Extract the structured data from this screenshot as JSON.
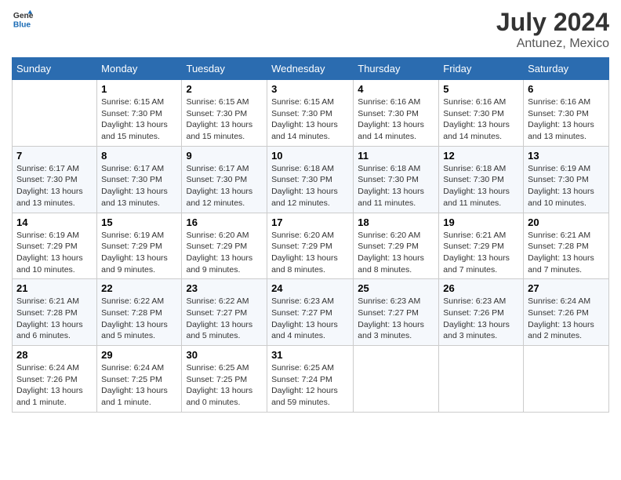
{
  "header": {
    "logo_line1": "General",
    "logo_line2": "Blue",
    "month_year": "July 2024",
    "location": "Antunez, Mexico"
  },
  "days_of_week": [
    "Sunday",
    "Monday",
    "Tuesday",
    "Wednesday",
    "Thursday",
    "Friday",
    "Saturday"
  ],
  "weeks": [
    [
      {
        "day": "",
        "info": ""
      },
      {
        "day": "1",
        "info": "Sunrise: 6:15 AM\nSunset: 7:30 PM\nDaylight: 13 hours and 15 minutes."
      },
      {
        "day": "2",
        "info": "Sunrise: 6:15 AM\nSunset: 7:30 PM\nDaylight: 13 hours and 15 minutes."
      },
      {
        "day": "3",
        "info": "Sunrise: 6:15 AM\nSunset: 7:30 PM\nDaylight: 13 hours and 14 minutes."
      },
      {
        "day": "4",
        "info": "Sunrise: 6:16 AM\nSunset: 7:30 PM\nDaylight: 13 hours and 14 minutes."
      },
      {
        "day": "5",
        "info": "Sunrise: 6:16 AM\nSunset: 7:30 PM\nDaylight: 13 hours and 14 minutes."
      },
      {
        "day": "6",
        "info": "Sunrise: 6:16 AM\nSunset: 7:30 PM\nDaylight: 13 hours and 13 minutes."
      }
    ],
    [
      {
        "day": "7",
        "info": "Sunrise: 6:17 AM\nSunset: 7:30 PM\nDaylight: 13 hours and 13 minutes."
      },
      {
        "day": "8",
        "info": "Sunrise: 6:17 AM\nSunset: 7:30 PM\nDaylight: 13 hours and 13 minutes."
      },
      {
        "day": "9",
        "info": "Sunrise: 6:17 AM\nSunset: 7:30 PM\nDaylight: 13 hours and 12 minutes."
      },
      {
        "day": "10",
        "info": "Sunrise: 6:18 AM\nSunset: 7:30 PM\nDaylight: 13 hours and 12 minutes."
      },
      {
        "day": "11",
        "info": "Sunrise: 6:18 AM\nSunset: 7:30 PM\nDaylight: 13 hours and 11 minutes."
      },
      {
        "day": "12",
        "info": "Sunrise: 6:18 AM\nSunset: 7:30 PM\nDaylight: 13 hours and 11 minutes."
      },
      {
        "day": "13",
        "info": "Sunrise: 6:19 AM\nSunset: 7:30 PM\nDaylight: 13 hours and 10 minutes."
      }
    ],
    [
      {
        "day": "14",
        "info": "Sunrise: 6:19 AM\nSunset: 7:29 PM\nDaylight: 13 hours and 10 minutes."
      },
      {
        "day": "15",
        "info": "Sunrise: 6:19 AM\nSunset: 7:29 PM\nDaylight: 13 hours and 9 minutes."
      },
      {
        "day": "16",
        "info": "Sunrise: 6:20 AM\nSunset: 7:29 PM\nDaylight: 13 hours and 9 minutes."
      },
      {
        "day": "17",
        "info": "Sunrise: 6:20 AM\nSunset: 7:29 PM\nDaylight: 13 hours and 8 minutes."
      },
      {
        "day": "18",
        "info": "Sunrise: 6:20 AM\nSunset: 7:29 PM\nDaylight: 13 hours and 8 minutes."
      },
      {
        "day": "19",
        "info": "Sunrise: 6:21 AM\nSunset: 7:29 PM\nDaylight: 13 hours and 7 minutes."
      },
      {
        "day": "20",
        "info": "Sunrise: 6:21 AM\nSunset: 7:28 PM\nDaylight: 13 hours and 7 minutes."
      }
    ],
    [
      {
        "day": "21",
        "info": "Sunrise: 6:21 AM\nSunset: 7:28 PM\nDaylight: 13 hours and 6 minutes."
      },
      {
        "day": "22",
        "info": "Sunrise: 6:22 AM\nSunset: 7:28 PM\nDaylight: 13 hours and 5 minutes."
      },
      {
        "day": "23",
        "info": "Sunrise: 6:22 AM\nSunset: 7:27 PM\nDaylight: 13 hours and 5 minutes."
      },
      {
        "day": "24",
        "info": "Sunrise: 6:23 AM\nSunset: 7:27 PM\nDaylight: 13 hours and 4 minutes."
      },
      {
        "day": "25",
        "info": "Sunrise: 6:23 AM\nSunset: 7:27 PM\nDaylight: 13 hours and 3 minutes."
      },
      {
        "day": "26",
        "info": "Sunrise: 6:23 AM\nSunset: 7:26 PM\nDaylight: 13 hours and 3 minutes."
      },
      {
        "day": "27",
        "info": "Sunrise: 6:24 AM\nSunset: 7:26 PM\nDaylight: 13 hours and 2 minutes."
      }
    ],
    [
      {
        "day": "28",
        "info": "Sunrise: 6:24 AM\nSunset: 7:26 PM\nDaylight: 13 hours and 1 minute."
      },
      {
        "day": "29",
        "info": "Sunrise: 6:24 AM\nSunset: 7:25 PM\nDaylight: 13 hours and 1 minute."
      },
      {
        "day": "30",
        "info": "Sunrise: 6:25 AM\nSunset: 7:25 PM\nDaylight: 13 hours and 0 minutes."
      },
      {
        "day": "31",
        "info": "Sunrise: 6:25 AM\nSunset: 7:24 PM\nDaylight: 12 hours and 59 minutes."
      },
      {
        "day": "",
        "info": ""
      },
      {
        "day": "",
        "info": ""
      },
      {
        "day": "",
        "info": ""
      }
    ]
  ]
}
